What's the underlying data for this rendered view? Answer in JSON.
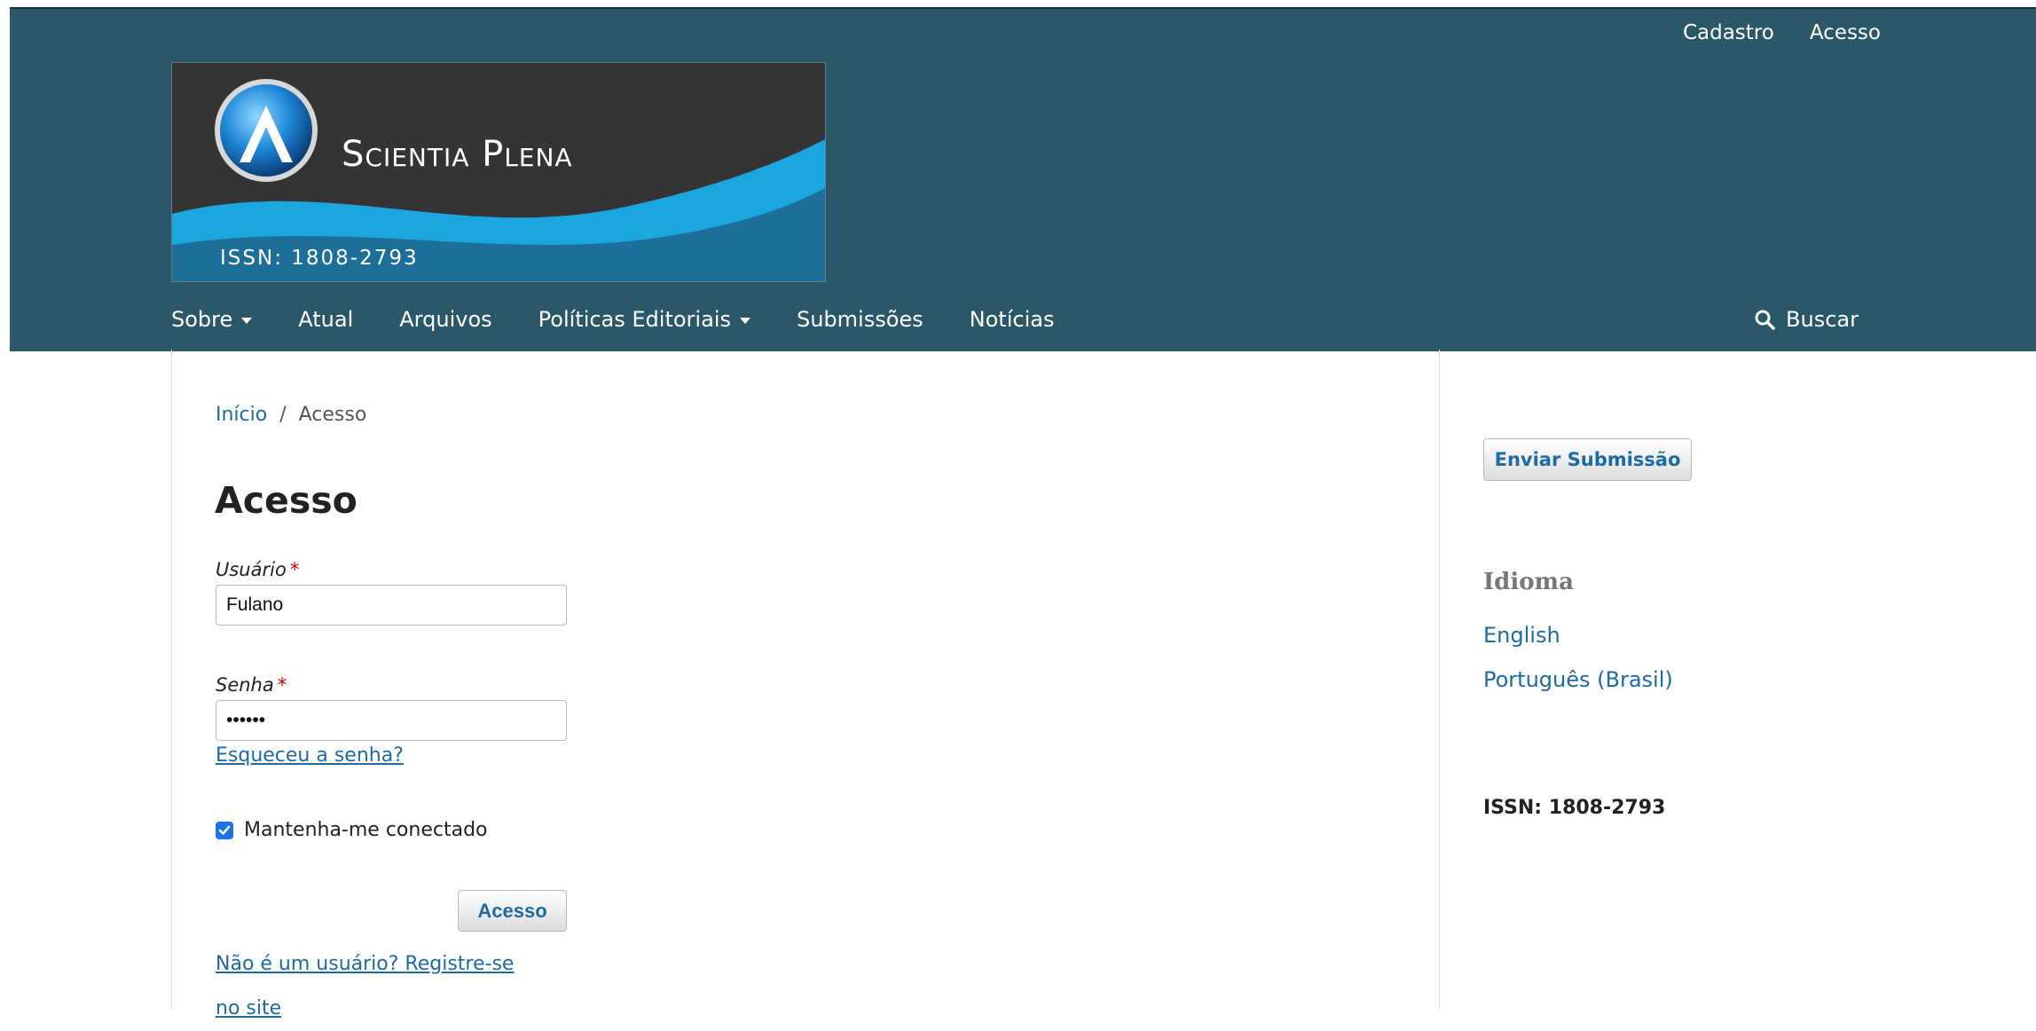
{
  "user_nav": {
    "register": "Cadastro",
    "login": "Acesso"
  },
  "logo": {
    "title": "Scientia Plena",
    "issn": "ISSN: 1808-2793"
  },
  "main_nav": {
    "items": [
      {
        "label": "Sobre",
        "has_dropdown": true
      },
      {
        "label": "Atual",
        "has_dropdown": false
      },
      {
        "label": "Arquivos",
        "has_dropdown": false
      },
      {
        "label": "Políticas Editoriais",
        "has_dropdown": true
      },
      {
        "label": "Submissões",
        "has_dropdown": false
      },
      {
        "label": "Notícias",
        "has_dropdown": false
      }
    ],
    "search_label": "Buscar"
  },
  "breadcrumb": {
    "home": "Início",
    "separator": "/",
    "current": "Acesso"
  },
  "page": {
    "title": "Acesso"
  },
  "form": {
    "username_label": "Usuário",
    "username_value": "Fulano",
    "password_label": "Senha",
    "password_value": "••••••",
    "required_marker": "*",
    "forgot_password": "Esqueceu a senha?",
    "remember_me": "Mantenha-me conectado",
    "remember_checked": true,
    "submit_label": "Acesso",
    "register_prompt": "Não é um usuário? Registre-se no site"
  },
  "sidebar": {
    "submit_button": "Enviar Submissão",
    "language_heading": "Idioma",
    "languages": [
      "English",
      "Português (Brasil)"
    ],
    "issn": "ISSN: 1808-2793"
  },
  "colors": {
    "header_bg": "#2a5869",
    "link": "#1e6ba3",
    "required": "#d00000",
    "checkbox": "#1a73e8"
  }
}
